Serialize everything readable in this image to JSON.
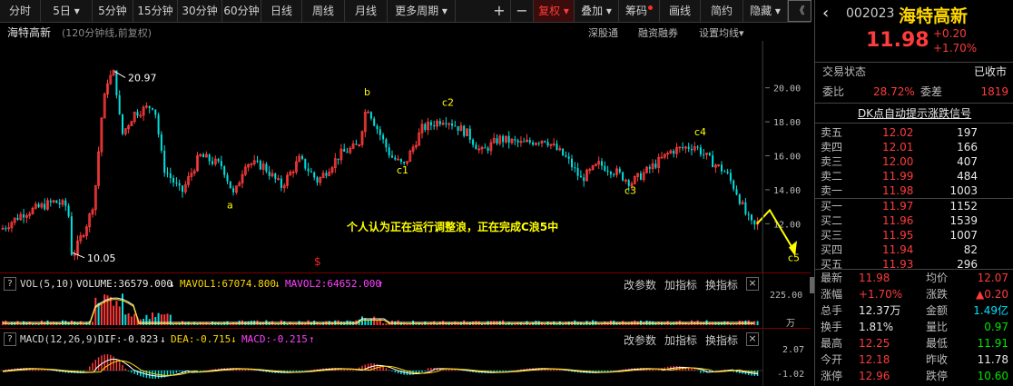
{
  "toolbar": {
    "items": [
      "分时",
      "5日",
      "5分钟",
      "15分钟",
      "30分钟",
      "60分钟",
      "日线",
      "周线",
      "月线",
      "更多周期",
      "+",
      "−",
      "复权",
      "叠加",
      "筹码",
      "画线",
      "简约",
      "隐藏"
    ],
    "dropdown_mark": "▾",
    "nav_icon": "《",
    "active": "复权"
  },
  "chart": {
    "stock_name": "海特高新",
    "subtitle": "(120分钟线,前复权)",
    "links": [
      "深股通",
      "融资融券",
      "设置均线"
    ],
    "settings_caret": "▾",
    "y_ticks": [
      "20.00",
      "18.00",
      "16.00",
      "14.00",
      "12.00"
    ],
    "high_label": "20.97",
    "low_label": "10.05",
    "wave_labels": [
      "a",
      "b",
      "c1",
      "c2",
      "c3",
      "c4",
      "c5"
    ],
    "annotation": "个人认为正在运行调整浪，正在完成C浪5中",
    "s_marker": "$",
    "colors": {
      "up": "#ff3b3b",
      "down": "#00e0e0",
      "annotation": "#ffff00"
    }
  },
  "vol_panel": {
    "toggle": "?",
    "name": "VOL(5,10)",
    "volume": "VOLUME:36579.000",
    "mavol1": "MAVOL1:67074.800",
    "mavol2": "MAVOL2:64652.000",
    "arrow_down": "↓",
    "arrow_up": "↑",
    "params_btn": "改参数",
    "add_btn": "加指标",
    "switch_btn": "换指标",
    "close": "×",
    "axis_top": "225.00",
    "axis_unit": "万"
  },
  "macd_panel": {
    "toggle": "?",
    "name": "MACD(12,26,9)",
    "dif": "DIF:-0.823",
    "dea": "DEA:-0.715",
    "macd": "MACD:-0.215",
    "arrow_down": "↓",
    "arrow_up": "↑",
    "params_btn": "改参数",
    "add_btn": "加指标",
    "switch_btn": "换指标",
    "close": "×",
    "axis_top": "2.07",
    "axis_bottom": "-1.02"
  },
  "quote": {
    "code": "002023",
    "name": "海特高新",
    "price": "11.98",
    "change": "+0.20",
    "pct": "+1.70%",
    "status_label": "交易状态",
    "status_value": "已收市",
    "ratio_label": "委比",
    "ratio_value": "28.72%",
    "diff_label": "委差",
    "diff_value": "1819",
    "signal": "DK点自动提示涨跌信号",
    "asks": [
      {
        "label": "卖五",
        "price": "12.02",
        "vol": "197"
      },
      {
        "label": "卖四",
        "price": "12.01",
        "vol": "166"
      },
      {
        "label": "卖三",
        "price": "12.00",
        "vol": "407"
      },
      {
        "label": "卖二",
        "price": "11.99",
        "vol": "484"
      },
      {
        "label": "卖一",
        "price": "11.98",
        "vol": "1003"
      }
    ],
    "bids": [
      {
        "label": "买一",
        "price": "11.97",
        "vol": "1152"
      },
      {
        "label": "买二",
        "price": "11.96",
        "vol": "1539"
      },
      {
        "label": "买三",
        "price": "11.95",
        "vol": "1007"
      },
      {
        "label": "买四",
        "price": "11.94",
        "vol": "82"
      },
      {
        "label": "买五",
        "price": "11.93",
        "vol": "296"
      }
    ],
    "stats": [
      {
        "l1": "最新",
        "v1": "11.98",
        "c1": "red",
        "l2": "均价",
        "v2": "12.07",
        "c2": "red"
      },
      {
        "l1": "涨幅",
        "v1": "+1.70%",
        "c1": "red",
        "l2": "涨跌",
        "v2": "▲0.20",
        "c2": "red"
      },
      {
        "l1": "总手",
        "v1": "12.37万",
        "c1": "white",
        "l2": "金额",
        "v2": "1.49亿",
        "c2": "cyan"
      },
      {
        "l1": "换手",
        "v1": "1.81%",
        "c1": "white",
        "l2": "量比",
        "v2": "0.97",
        "c2": "green"
      },
      {
        "l1": "最高",
        "v1": "12.25",
        "c1": "red",
        "l2": "最低",
        "v2": "11.91",
        "c2": "green"
      },
      {
        "l1": "今开",
        "v1": "12.18",
        "c1": "red",
        "l2": "昨收",
        "v2": "11.78",
        "c2": "white"
      },
      {
        "l1": "涨停",
        "v1": "12.96",
        "c1": "red",
        "l2": "跌停",
        "v2": "10.60",
        "c2": "green"
      }
    ]
  }
}
